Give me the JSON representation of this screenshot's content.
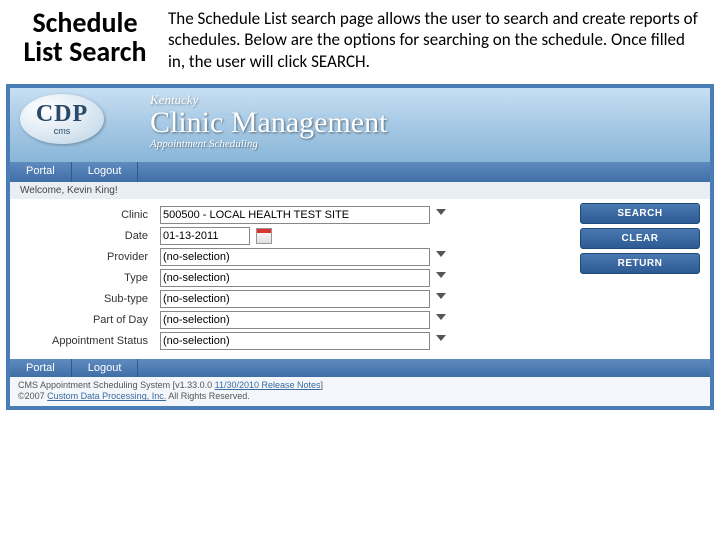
{
  "slide": {
    "title": "Schedule List Search",
    "description": "The Schedule List search page allows the user to search and create reports of schedules.  Below are the options for searching on the schedule.  Once filled in, the user will click SEARCH."
  },
  "logo": {
    "big": "CDP",
    "small": "cms"
  },
  "header": {
    "state": "Kentucky",
    "brand": "Clinic Management",
    "sub": "Appointment Scheduling"
  },
  "nav": {
    "portal": "Portal",
    "logout": "Logout"
  },
  "welcome": "Welcome, Kevin King!",
  "form": {
    "clinic": {
      "label": "Clinic",
      "value": "500500 - LOCAL HEALTH TEST SITE"
    },
    "date": {
      "label": "Date",
      "value": "01-13-2011"
    },
    "provider": {
      "label": "Provider",
      "value": "(no-selection)"
    },
    "type": {
      "label": "Type",
      "value": "(no-selection)"
    },
    "subtype": {
      "label": "Sub-type",
      "value": "(no-selection)"
    },
    "partofday": {
      "label": "Part of Day",
      "value": "(no-selection)"
    },
    "apptstatus": {
      "label": "Appointment Status",
      "value": "(no-selection)"
    }
  },
  "actions": {
    "search": "SEARCH",
    "clear": "CLEAR",
    "return": "RETURN"
  },
  "footer": {
    "line1a": "CMS Appointment Scheduling System [v1.33.0.0 ",
    "line1link": "11/30/2010 Release Notes",
    "line1b": "]",
    "line2a": "©2007 ",
    "line2link": "Custom Data Processing, Inc.",
    "line2b": " All Rights Reserved."
  }
}
